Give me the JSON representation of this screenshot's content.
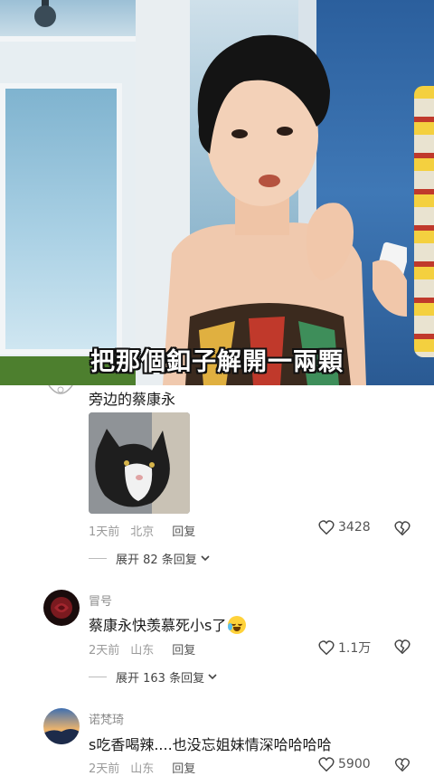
{
  "video": {
    "subtitle": "把那個釦子解開一兩顆"
  },
  "comments": [
    {
      "text": "旁边的蔡康永",
      "has_image": true,
      "time": "1天前",
      "location": "北京",
      "reply_label": "回复",
      "likes": "3428",
      "expand": "展开 82 条回复"
    },
    {
      "name": "冒号",
      "text": "蔡康永快羡慕死小s了",
      "emoji": "crying-laughing-emoji",
      "time": "2天前",
      "location": "山东",
      "reply_label": "回复",
      "likes": "1.1万",
      "expand": "展开 163 条回复"
    },
    {
      "name": "诺梵琦",
      "text": "s吃香喝辣....也没忘姐妹情深哈哈哈哈",
      "time": "2天前",
      "location": "山东",
      "reply_label": "回复",
      "likes": "5900"
    }
  ],
  "icons": {
    "like": "heart-icon",
    "dislike": "broken-heart-icon",
    "expand": "chevron-down-icon"
  },
  "colors": {
    "text_primary": "#1a1a1a",
    "text_secondary": "#9a9a9a",
    "subtitle_fill": "#ffffff",
    "subtitle_outline": "#111111"
  }
}
